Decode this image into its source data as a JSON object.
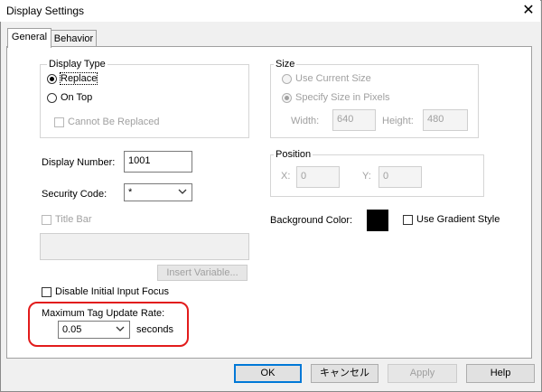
{
  "window": {
    "title": "Display Settings",
    "close_glyph": "✕"
  },
  "tabs": [
    {
      "label": "General"
    },
    {
      "label": "Behavior"
    }
  ],
  "display_type": {
    "legend": "Display Type",
    "replace_label": "Replace",
    "on_top_label": "On Top",
    "cannot_be_replaced_label": "Cannot Be Replaced",
    "selected": "Replace"
  },
  "size": {
    "legend": "Size",
    "use_current_label": "Use Current Size",
    "specify_label": "Specify Size in Pixels",
    "width_label": "Width:",
    "width_value": "640",
    "height_label": "Height:",
    "height_value": "480"
  },
  "display_number": {
    "label": "Display Number:",
    "value": "1001"
  },
  "security_code": {
    "label": "Security Code:",
    "value": "*"
  },
  "position": {
    "legend": "Position",
    "x_label": "X:",
    "x_value": "0",
    "y_label": "Y:",
    "y_value": "0"
  },
  "background_color": {
    "label": "Background Color:",
    "color": "#000000"
  },
  "use_gradient": {
    "label": "Use Gradient Style"
  },
  "title_bar": {
    "label": "Title Bar"
  },
  "insert_variable": {
    "label": "Insert Variable..."
  },
  "disable_initial_input_focus": {
    "label": "Disable Initial Input Focus"
  },
  "max_tag_update_rate": {
    "label": "Maximum Tag Update Rate:",
    "value": "0.05",
    "unit": "seconds"
  },
  "buttons": {
    "ok": "OK",
    "cancel": "キャンセル",
    "apply": "Apply",
    "help": "Help"
  }
}
